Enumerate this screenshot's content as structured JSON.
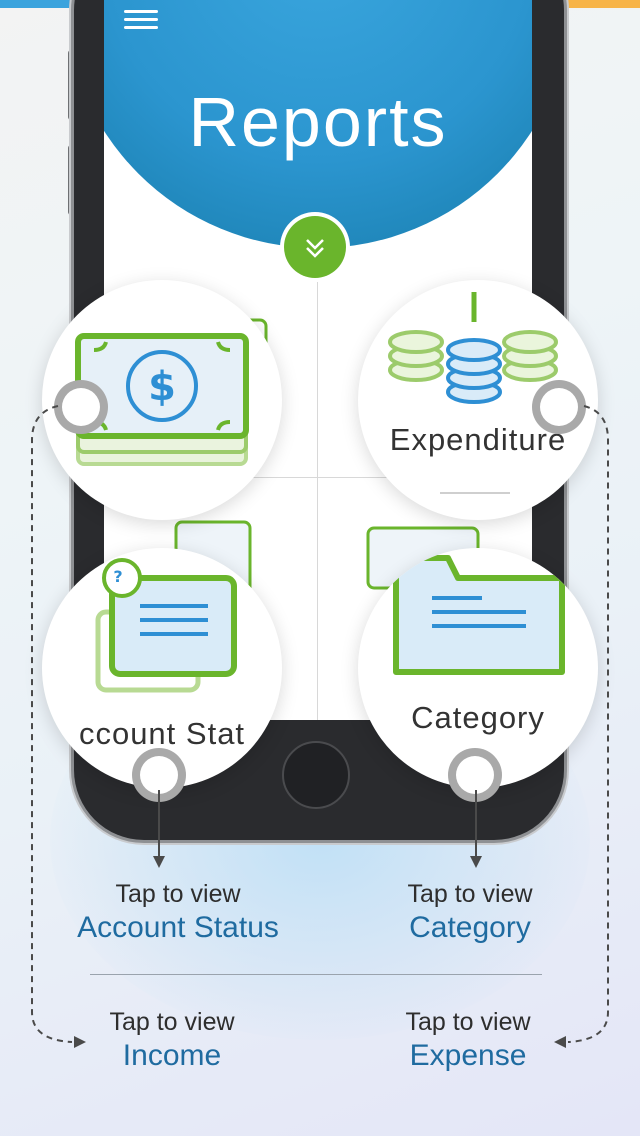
{
  "colors": {
    "accent_green": "#6ab52c",
    "screen_blue": "#2b95cf",
    "link_blue": "#1f6ba0",
    "topbar": [
      "#3ba3dd",
      "#ffffff",
      "#e8505b",
      "#f7b448"
    ]
  },
  "screen": {
    "menu_icon": "hamburger-icon",
    "title": "Reports",
    "toggle_icon": "double-chevron-down-icon"
  },
  "bubbles": {
    "income": {
      "icon": "money-stack-icon"
    },
    "expenditure": {
      "label": "Expenditure",
      "icon": "coin-stacks-icon"
    },
    "account_status": {
      "label": "ccount Stat",
      "icon": "documents-icon"
    },
    "category": {
      "label": "Category",
      "icon": "folder-icon"
    }
  },
  "captions": {
    "account_status": {
      "prefix": "Tap to view",
      "target": "Account Status"
    },
    "category": {
      "prefix": "Tap to view",
      "target": "Category"
    },
    "income": {
      "prefix": "Tap to view",
      "target": "Income"
    },
    "expense": {
      "prefix": "Tap to view",
      "target": "Expense"
    }
  }
}
